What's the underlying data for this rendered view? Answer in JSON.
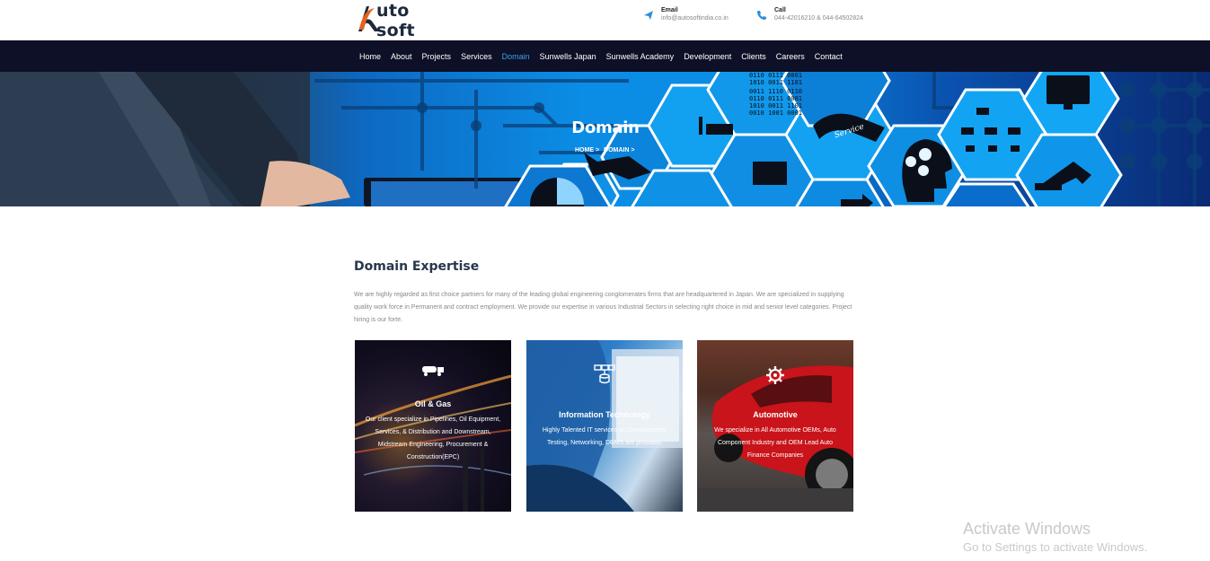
{
  "header": {
    "logo_text": "uto soft",
    "email": {
      "title": "Email",
      "value": "info@autosoftindia.co.in"
    },
    "call": {
      "title": "Call",
      "value": "044-42016210 & 044-64502824"
    }
  },
  "nav": {
    "items": [
      "Home",
      "About",
      "Projects",
      "Services",
      "Domain",
      "Sunwells Japan",
      "Sunwells Academy",
      "Development",
      "Clients",
      "Careers",
      "Contact"
    ],
    "active": "Domain"
  },
  "banner": {
    "title": "Domain",
    "breadcrumb": [
      "HOME >",
      "DOMAIN >"
    ],
    "binary_rows": [
      "0110 0111 0001",
      "1010 0011 1101",
      "0011 1110 0110",
      "0110 0111 0001",
      "1010 0011 1101",
      "0010 1001 0001"
    ],
    "service_label": "Service"
  },
  "main": {
    "title": "Domain Expertise",
    "intro": "We are highly regarded as first choice partners for many of the leading global engineering conglomerates firms that are headquartered in Japan. We are specialized in supplying quality work force in Permanent and contract employment. We provide our expertise in various Industrial Sectors in selecting right choice in mid and senior level categories. Project hiring is our forte.",
    "cards": [
      {
        "title": "Oil & Gas",
        "text": "Our client specialize in Pipelines, Oil Equipment, Services, & Distribution and Downstream, Midstream Engineering, Procurement & Construction(EPC)"
      },
      {
        "title": "Information Technology",
        "text": "Highly Talented IT services on Development, Testing, Networking, DBMS are provided."
      },
      {
        "title": "Automotive",
        "text": "We specialize in All Automotive OEMs, Auto Component Industry and OEM Lead Auto Finance Companies"
      }
    ]
  },
  "watermark": {
    "line1": "Activate Windows",
    "line2": "Go to Settings to activate Windows."
  },
  "colors": {
    "nav_bg": "#0d1026",
    "active": "#3aa3ee",
    "heading": "#27374d",
    "logo_orange": "#e8611a"
  }
}
